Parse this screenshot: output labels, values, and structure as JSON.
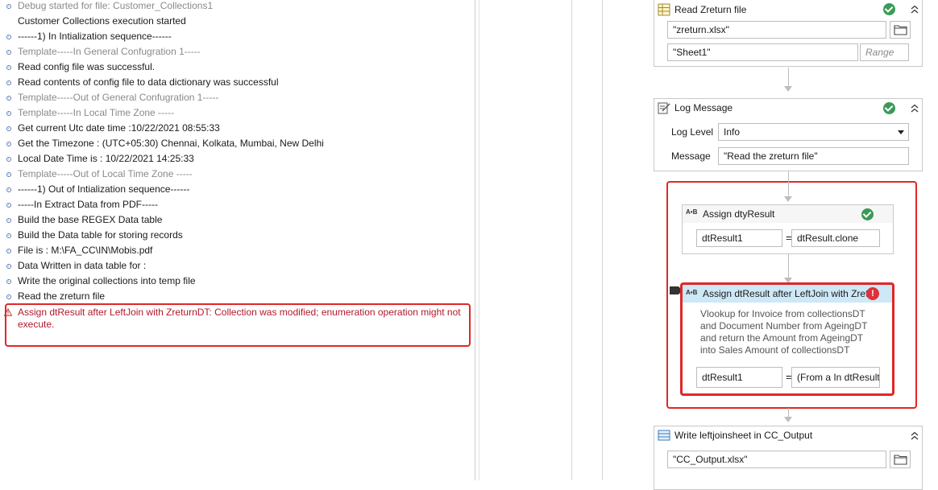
{
  "output_log": {
    "entries": [
      {
        "text": "Debug started for file: Customer_Collections1",
        "style": "trace"
      },
      {
        "text": "Customer Collections execution started",
        "style": "normal"
      },
      {
        "text": "------1) In Intialization sequence------",
        "style": "info"
      },
      {
        "text": "Template-----In General Confugration 1-----",
        "style": "trace-info"
      },
      {
        "text": "Read config file was successful.",
        "style": "info"
      },
      {
        "text": "Read contents of config file to data dictionary was successful",
        "style": "info"
      },
      {
        "text": "Template-----Out of General Confugration 1-----",
        "style": "trace-info"
      },
      {
        "text": "Template-----In Local Time Zone -----",
        "style": "trace-info"
      },
      {
        "text": "Get current Utc date time :10/22/2021 08:55:33",
        "style": "info"
      },
      {
        "text": "Get the Timezone : (UTC+05:30) Chennai, Kolkata, Mumbai, New Delhi",
        "style": "info"
      },
      {
        "text": "Local Date Time is : 10/22/2021 14:25:33",
        "style": "info"
      },
      {
        "text": "Template-----Out of Local Time Zone -----",
        "style": "trace-info"
      },
      {
        "text": "------1) Out of Intialization sequence------",
        "style": "info"
      },
      {
        "text": "-----In Extract Data from PDF-----",
        "style": "info"
      },
      {
        "text": "Build the base REGEX Data table",
        "style": "info"
      },
      {
        "text": "Build the  Data table for storing records",
        "style": "info"
      },
      {
        "text": "File is : M:\\FA_CC\\IN\\Mobis.pdf",
        "style": "info"
      },
      {
        "text": "Data Written in data table for :",
        "style": "info"
      },
      {
        "text": "Write the original collections into temp file",
        "style": "info"
      },
      {
        "text": "Read the zreturn file",
        "style": "info"
      }
    ],
    "error": {
      "text": "Assign dtResult after LeftJoin with ZreturnDT: Collection was modified; enumeration operation might not execute.",
      "color": "#b3182d"
    }
  },
  "designer": {
    "read_zreturn": {
      "title": "Read Zreturn file",
      "file": "\"zreturn.xlsx\"",
      "sheet": "\"Sheet1\"",
      "range_placeholder": "Range"
    },
    "log_message": {
      "title": "Log Message",
      "level_label": "Log Level",
      "level_value": "Info",
      "message_label": "Message",
      "message_value": "\"Read the zreturn file\""
    },
    "assign_dty": {
      "title": "Assign dtyResult",
      "to": "dtResult1",
      "eq": "=",
      "value": "dtResult.clone"
    },
    "assign_leftjoin": {
      "title": "Assign dtResult after LeftJoin with Zret",
      "annotation_lines": [
        "Vlookup for Invoice from collectionsDT",
        "and Document  Number from AgeingDT",
        "and return the Amount from AgeingDT",
        "into Sales Amount of collectionsDT"
      ],
      "to": "dtResult1",
      "eq": "=",
      "value": "(From a In dtResult"
    },
    "write_sheet": {
      "title": "Write leftjoinsheet in CC_Output",
      "file": "\"CC_Output.xlsx\""
    }
  },
  "colors": {
    "error": "#e12626",
    "success": "#3b9a57",
    "selected_header": "#cde8f7"
  }
}
